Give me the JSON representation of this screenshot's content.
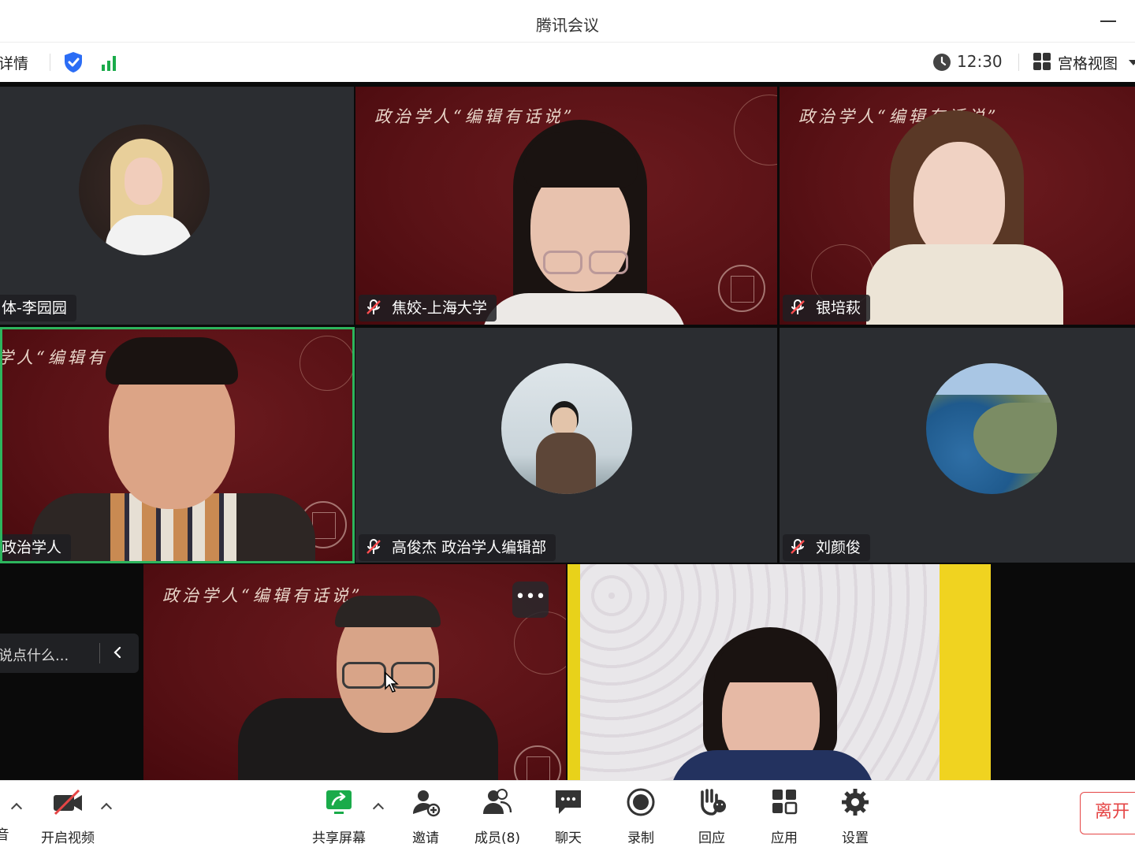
{
  "window": {
    "title": "腾讯会议"
  },
  "infobar": {
    "details_label": "详情",
    "time": "12:30",
    "view_label": "宫格视图"
  },
  "colors": {
    "accent": "#2b6df5",
    "speaking": "#2db55d",
    "leave": "#e54545",
    "signal": "#1aab4a"
  },
  "tiles": [
    {
      "name": "体-李园园",
      "muted": false,
      "banner": ""
    },
    {
      "name": "焦姣-上海大学",
      "muted": true,
      "banner": "政治学人“编辑有话说”"
    },
    {
      "name": "银培萩",
      "muted": true,
      "banner": "政治学人“编辑有话说”"
    },
    {
      "name": "政治学人",
      "muted": false,
      "banner": "学人“编辑有"
    },
    {
      "name": "高俊杰 政治学人编辑部",
      "muted": true,
      "banner": ""
    },
    {
      "name": "刘颜俊",
      "muted": true,
      "banner": ""
    },
    {
      "name": "",
      "muted": true,
      "banner": "政治学人“编辑有话说”"
    },
    {
      "name": "",
      "muted": false,
      "banner": ""
    }
  ],
  "chat": {
    "placeholder": "说点什么..."
  },
  "more_label": "•••",
  "toolbar": {
    "audio_label": "音",
    "video_label": "开启视频",
    "share_label": "共享屏幕",
    "invite_label": "邀请",
    "members_label": "成员(8)",
    "chat_label": "聊天",
    "record_label": "录制",
    "react_label": "回应",
    "apps_label": "应用",
    "settings_label": "设置",
    "leave_label": "离开"
  }
}
